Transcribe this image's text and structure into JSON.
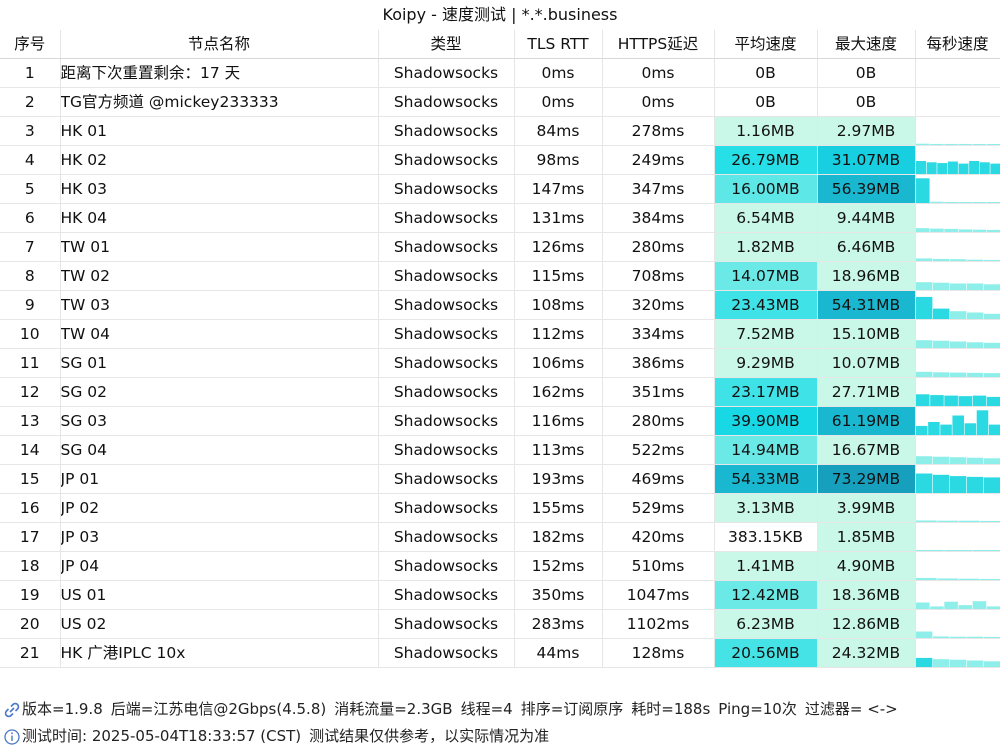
{
  "window": {
    "title": "Koipy - 速度测试 | *.*.business"
  },
  "table": {
    "headers": [
      "序号",
      "节点名称",
      "类型",
      "TLS RTT",
      "HTTPS延迟",
      "平均速度",
      "最大速度",
      "每秒速度"
    ],
    "rows": [
      {
        "idx": "1",
        "name": "距离下次重置剩余：17 天",
        "type": "Shadowsocks",
        "tls": "0ms",
        "https": "0ms",
        "avg": "0B",
        "max": "0B",
        "avg_color": "#ffffff",
        "max_color": "#ffffff",
        "spark": []
      },
      {
        "idx": "2",
        "name": "TG官方频道 @mickey233333",
        "type": "Shadowsocks",
        "tls": "0ms",
        "https": "0ms",
        "avg": "0B",
        "max": "0B",
        "avg_color": "#ffffff",
        "max_color": "#ffffff",
        "spark": []
      },
      {
        "idx": "3",
        "name": "HK 01",
        "type": "Shadowsocks",
        "tls": "84ms",
        "https": "278ms",
        "avg": "1.16MB",
        "max": "2.97MB",
        "avg_color": "#c9f7e8",
        "max_color": "#c9f7e8",
        "spark": [
          0.05,
          0.04,
          0.04,
          0.04,
          0.03,
          0.03
        ]
      },
      {
        "idx": "4",
        "name": "HK 02",
        "type": "Shadowsocks",
        "tls": "98ms",
        "https": "249ms",
        "avg": "26.79MB",
        "max": "31.07MB",
        "avg_color": "#27dfe6",
        "max_color": "#17cfe0",
        "spark": [
          0.5,
          0.45,
          0.42,
          0.48,
          0.4,
          0.5,
          0.45,
          0.4
        ]
      },
      {
        "idx": "5",
        "name": "HK 03",
        "type": "Shadowsocks",
        "tls": "147ms",
        "https": "347ms",
        "avg": "16.00MB",
        "max": "56.39MB",
        "avg_color": "#5de7e6",
        "max_color": "#1ab8d0",
        "spark": [
          0.95,
          0.05,
          0.04,
          0.03,
          0.03,
          0.03
        ]
      },
      {
        "idx": "6",
        "name": "HK 04",
        "type": "Shadowsocks",
        "tls": "131ms",
        "https": "384ms",
        "avg": "6.54MB",
        "max": "9.44MB",
        "avg_color": "#c9f7e8",
        "max_color": "#c9f7e8",
        "spark": [
          0.15,
          0.13,
          0.12,
          0.1,
          0.09,
          0.08
        ]
      },
      {
        "idx": "7",
        "name": "TW 01",
        "type": "Shadowsocks",
        "tls": "126ms",
        "https": "280ms",
        "avg": "1.82MB",
        "max": "6.46MB",
        "avg_color": "#c9f7e8",
        "max_color": "#c9f7e8",
        "spark": [
          0.1,
          0.08,
          0.07,
          0.05,
          0.04
        ]
      },
      {
        "idx": "8",
        "name": "TW 02",
        "type": "Shadowsocks",
        "tls": "115ms",
        "https": "708ms",
        "avg": "14.07MB",
        "max": "18.96MB",
        "avg_color": "#6ae9e6",
        "max_color": "#c9f7e8",
        "spark": [
          0.3,
          0.28,
          0.25,
          0.25,
          0.22
        ]
      },
      {
        "idx": "9",
        "name": "TW 03",
        "type": "Shadowsocks",
        "tls": "108ms",
        "https": "320ms",
        "avg": "23.43MB",
        "max": "54.31MB",
        "avg_color": "#3fe2e6",
        "max_color": "#1ab8d0",
        "spark": [
          0.85,
          0.4,
          0.3,
          0.25,
          0.2
        ]
      },
      {
        "idx": "10",
        "name": "TW 04",
        "type": "Shadowsocks",
        "tls": "112ms",
        "https": "334ms",
        "avg": "7.52MB",
        "max": "15.10MB",
        "avg_color": "#c9f7e8",
        "max_color": "#c9f7e8",
        "spark": [
          0.3,
          0.28,
          0.25,
          0.22,
          0.2
        ]
      },
      {
        "idx": "11",
        "name": "SG 01",
        "type": "Shadowsocks",
        "tls": "106ms",
        "https": "386ms",
        "avg": "9.29MB",
        "max": "10.07MB",
        "avg_color": "#c9f7e8",
        "max_color": "#c9f7e8",
        "spark": [
          0.2,
          0.18,
          0.17,
          0.16,
          0.15
        ]
      },
      {
        "idx": "12",
        "name": "SG 02",
        "type": "Shadowsocks",
        "tls": "162ms",
        "https": "351ms",
        "avg": "23.17MB",
        "max": "27.71MB",
        "avg_color": "#3fe2e6",
        "max_color": "#c9f7e8",
        "spark": [
          0.45,
          0.42,
          0.4,
          0.38,
          0.4,
          0.35
        ]
      },
      {
        "idx": "13",
        "name": "SG 03",
        "type": "Shadowsocks",
        "tls": "116ms",
        "https": "280ms",
        "avg": "39.90MB",
        "max": "61.19MB",
        "avg_color": "#18d8e6",
        "max_color": "#1ab8d0",
        "spark": [
          0.35,
          0.5,
          0.4,
          0.75,
          0.45,
          0.95,
          0.4
        ]
      },
      {
        "idx": "14",
        "name": "SG 04",
        "type": "Shadowsocks",
        "tls": "113ms",
        "https": "522ms",
        "avg": "14.94MB",
        "max": "16.67MB",
        "avg_color": "#6ae9e6",
        "max_color": "#c9f7e8",
        "spark": [
          0.3,
          0.28,
          0.26,
          0.24,
          0.22
        ]
      },
      {
        "idx": "15",
        "name": "JP 01",
        "type": "Shadowsocks",
        "tls": "193ms",
        "https": "469ms",
        "avg": "54.33MB",
        "max": "73.29MB",
        "avg_color": "#1ab8d0",
        "max_color": "#179fbe",
        "spark": [
          0.75,
          0.7,
          0.65,
          0.62,
          0.6
        ]
      },
      {
        "idx": "16",
        "name": "JP 02",
        "type": "Shadowsocks",
        "tls": "155ms",
        "https": "529ms",
        "avg": "3.13MB",
        "max": "3.99MB",
        "avg_color": "#c9f7e8",
        "max_color": "#c9f7e8",
        "spark": [
          0.06,
          0.05,
          0.05,
          0.04
        ]
      },
      {
        "idx": "17",
        "name": "JP 03",
        "type": "Shadowsocks",
        "tls": "182ms",
        "https": "420ms",
        "avg": "383.15KB",
        "max": "1.85MB",
        "avg_color": "#ffffff",
        "max_color": "#c9f7e8",
        "spark": [
          0.04,
          0.03,
          0.03
        ]
      },
      {
        "idx": "18",
        "name": "JP 04",
        "type": "Shadowsocks",
        "tls": "152ms",
        "https": "510ms",
        "avg": "1.41MB",
        "max": "4.90MB",
        "avg_color": "#c9f7e8",
        "max_color": "#c9f7e8",
        "spark": [
          0.08,
          0.06,
          0.05,
          0.04
        ]
      },
      {
        "idx": "19",
        "name": "US 01",
        "type": "Shadowsocks",
        "tls": "350ms",
        "https": "1047ms",
        "avg": "12.42MB",
        "max": "18.36MB",
        "avg_color": "#6ae9e6",
        "max_color": "#c9f7e8",
        "spark": [
          0.25,
          0.1,
          0.28,
          0.15,
          0.3,
          0.1
        ]
      },
      {
        "idx": "20",
        "name": "US 02",
        "type": "Shadowsocks",
        "tls": "283ms",
        "https": "1102ms",
        "avg": "6.23MB",
        "max": "12.86MB",
        "avg_color": "#c9f7e8",
        "max_color": "#c9f7e8",
        "spark": [
          0.25,
          0.06,
          0.05,
          0.05,
          0.04
        ]
      },
      {
        "idx": "21",
        "name": "HK 广港IPLC 10x",
        "type": "Shadowsocks",
        "tls": "44ms",
        "https": "128ms",
        "avg": "20.56MB",
        "max": "24.32MB",
        "avg_color": "#45e3e6",
        "max_color": "#c9f7e8",
        "spark": [
          0.35,
          0.3,
          0.28,
          0.25,
          0.22
        ]
      }
    ]
  },
  "footer": {
    "line1": {
      "icon": "link-icon",
      "version": "版本=1.9.8",
      "backend": "后端=江苏电信@2Gbps(4.5.8)",
      "traffic": "消耗流量=2.3GB",
      "threads": "线程=4",
      "sort": "排序=订阅原序",
      "duration": "耗时=188s",
      "ping": "Ping=10次",
      "filter": "过滤器= <->"
    },
    "line2": {
      "icon": "info-icon",
      "time": "测试时间: 2025-05-04T18:33:57 (CST)",
      "note": "测试结果仅供参考，以实际情况为准"
    }
  },
  "colors": {
    "spark_bar": "#2bd9e3",
    "spark_bar_light": "#8eefea",
    "grid": "#e6e6e6"
  }
}
